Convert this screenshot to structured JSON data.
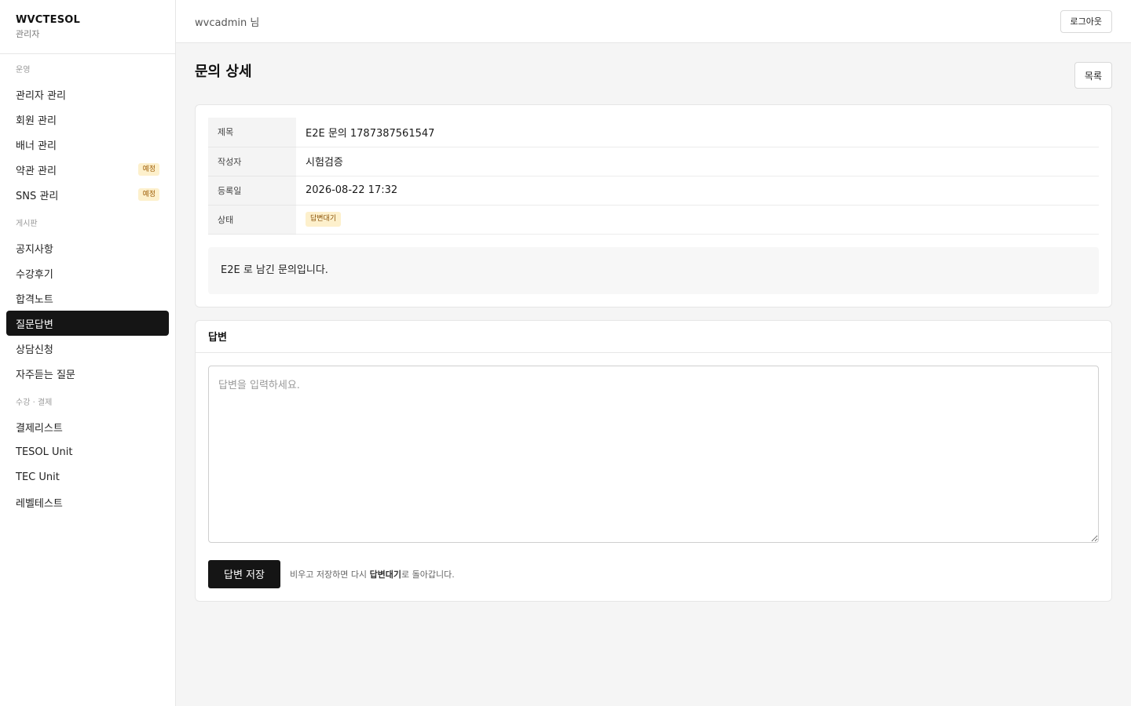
{
  "brand": {
    "name": "WVCTESOL",
    "sub": "관리자"
  },
  "sidebar": {
    "sections": [
      {
        "title": "운영",
        "items": [
          {
            "label": "관리자 관리"
          },
          {
            "label": "회원 관리"
          },
          {
            "label": "배너 관리"
          },
          {
            "label": "약관 관리",
            "badge": "예정"
          },
          {
            "label": "SNS 관리",
            "badge": "예정"
          }
        ]
      },
      {
        "title": "게시판",
        "items": [
          {
            "label": "공지사항"
          },
          {
            "label": "수강후기"
          },
          {
            "label": "합격노트"
          },
          {
            "label": "질문답변",
            "active": true
          },
          {
            "label": "상담신청"
          },
          {
            "label": "자주듣는 질문"
          }
        ]
      },
      {
        "title": "수강 · 결제",
        "items": [
          {
            "label": "결제리스트"
          },
          {
            "label": "TESOL Unit"
          },
          {
            "label": "TEC Unit"
          },
          {
            "label": "레벨테스트"
          }
        ]
      }
    ]
  },
  "topbar": {
    "user": "wvcadmin 님",
    "logout_label": "로그아웃"
  },
  "page": {
    "title": "문의 상세",
    "list_button": "목록"
  },
  "detail": {
    "rows": [
      {
        "label": "제목",
        "value": "E2E 문의 1787387561547"
      },
      {
        "label": "작성자",
        "value": "시험검증"
      },
      {
        "label": "등록일",
        "value": "2026-08-22 17:32"
      }
    ],
    "status_label": "상태",
    "status_value": "답변대기",
    "content": "E2E 로 남긴 문의입니다."
  },
  "answer": {
    "title": "답변",
    "placeholder": "답변을 입력하세요.",
    "value": "",
    "save_label": "답변 저장",
    "hint_prefix": "비우고 저장하면 다시 ",
    "hint_bold": "답변대기",
    "hint_suffix": "로 돌아갑니다."
  },
  "colors": {
    "accent": "#151515",
    "badge_bg": "#fdf0cc",
    "badge_text": "#a0600a"
  }
}
